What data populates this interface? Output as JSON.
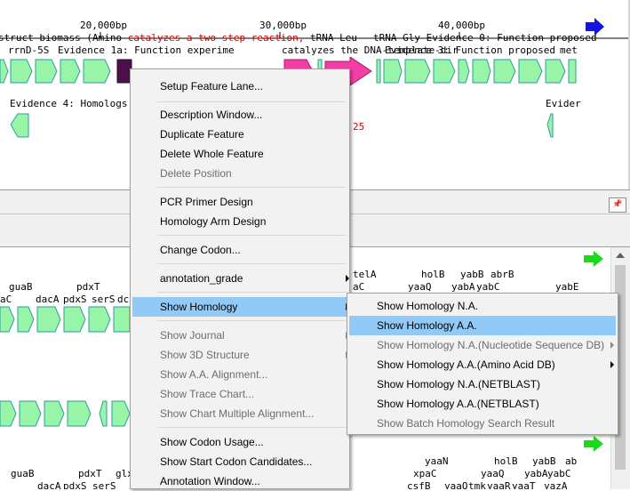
{
  "ruler": {
    "ticks": [
      "20,000bp",
      "30,000bp",
      "40,000bp"
    ]
  },
  "top_pane": {
    "row0_text": "struct biomass (Amino",
    "row0_red": "catalyzes a two step reaction,",
    "row0_mid": "tRNA-Leu",
    "row0_right": "tRNA-Gly Evidence 0: Function proposed",
    "row1_labels": [
      "rrnD-5S",
      "Evidence 1a: Function experime",
      "catalyzes the DNA-template-dir",
      "Evidence 3: Function proposed",
      "met"
    ],
    "row2_labels": [
      "Evidence 4: Homologs of",
      "Evider"
    ],
    "red_number": "25"
  },
  "bottom_pane": {
    "row_a_right": [
      "telA",
      "holB",
      "yabB",
      "abrB"
    ],
    "row_b_left": [
      "guaB",
      "pdxT"
    ],
    "row_b_right": [
      "aC",
      "yaaQ",
      "yabA",
      "yabC",
      "yabE"
    ],
    "row_c_left": [
      "aC",
      "dacA",
      "pdxS",
      "serS",
      "dcl"
    ],
    "row_d": [
      "guaB",
      "pdxT",
      "glx",
      "yaaN",
      "holB",
      "yabB",
      "ab"
    ],
    "row_e": [
      "dacA",
      "pdxS",
      "serS",
      "xpaC",
      "yaaQ",
      "yabA",
      "yabC"
    ],
    "row_f": [
      "csfB",
      "yaaQ",
      "tmk",
      "yaaR",
      "yaaT",
      "yazA"
    ]
  },
  "context_menu": {
    "items": [
      {
        "label": "Setup Feature Lane...",
        "disabled": false
      },
      {
        "label": "Description Window...",
        "disabled": false
      },
      {
        "label": "Duplicate Feature",
        "disabled": false
      },
      {
        "label": "Delete Whole Feature",
        "disabled": false
      },
      {
        "label": "Delete Position",
        "disabled": true
      },
      {
        "label": "PCR Primer Design",
        "disabled": false
      },
      {
        "label": "Homology Arm Design",
        "disabled": false
      },
      {
        "label": "Change Codon...",
        "disabled": false
      },
      {
        "label": "annotation_grade",
        "disabled": false
      },
      {
        "label": "Show Homology",
        "disabled": false
      },
      {
        "label": "Show Journal",
        "disabled": true
      },
      {
        "label": "Show 3D Structure",
        "disabled": true
      },
      {
        "label": "Show A.A. Alignment...",
        "disabled": true
      },
      {
        "label": "Show Trace Chart...",
        "disabled": true
      },
      {
        "label": "Show Chart Multiple Alignment...",
        "disabled": true
      },
      {
        "label": "Show Codon Usage...",
        "disabled": false
      },
      {
        "label": "Show Start Codon Candidates...",
        "disabled": false
      },
      {
        "label": "Annotation Window...",
        "disabled": false
      }
    ]
  },
  "submenu": {
    "items": [
      {
        "label": "Show Homology N.A.",
        "disabled": false
      },
      {
        "label": "Show Homology A.A.",
        "disabled": false
      },
      {
        "label": "Show Homology N.A.(Nucleotide Sequence DB)",
        "disabled": true
      },
      {
        "label": "Show Homology A.A.(Amino Acid DB)",
        "disabled": false
      },
      {
        "label": "Show Homology N.A.(NETBLAST)",
        "disabled": false
      },
      {
        "label": "Show Homology A.A.(NETBLAST)",
        "disabled": false
      },
      {
        "label": "Show Batch Homology Search Result",
        "disabled": true
      }
    ]
  },
  "colors": {
    "gene_fill": "#98f5a8",
    "gene_stroke": "#2e9c9c",
    "pink_fill": "#f33ea6",
    "dark_fill": "#4b0f49",
    "nav_blue": "#1414e0",
    "nav_green": "#1ed81e",
    "highlight": "#91c9f7"
  }
}
